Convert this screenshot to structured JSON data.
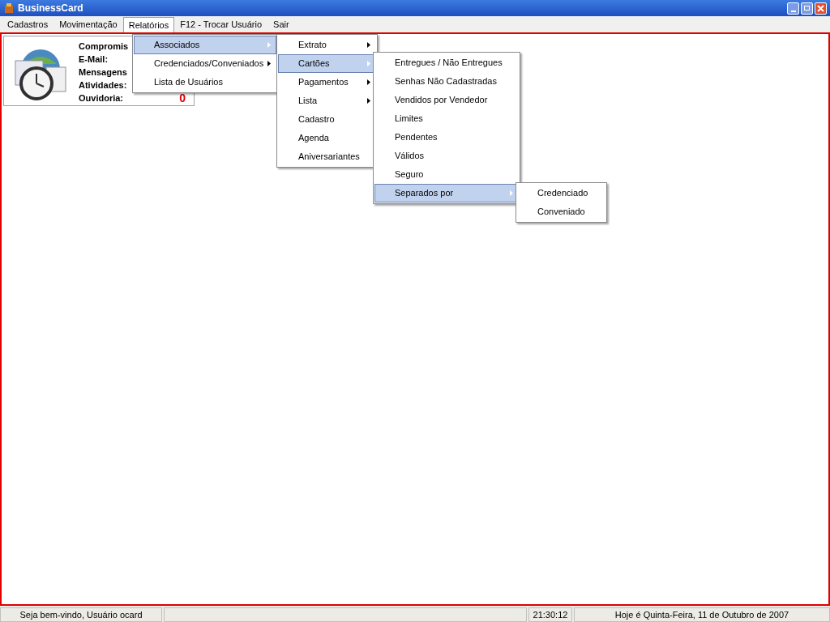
{
  "window": {
    "title": "BusinessCard"
  },
  "menubar": [
    {
      "label": "Cadastros",
      "selected": false
    },
    {
      "label": "Movimentação",
      "selected": false
    },
    {
      "label": "Relatórios",
      "selected": true
    },
    {
      "label": "F12 - Trocar Usuário",
      "selected": false
    },
    {
      "label": "Sair",
      "selected": false
    }
  ],
  "info_card": {
    "rows": [
      {
        "label": "Compromis"
      },
      {
        "label": "E-Mail:"
      },
      {
        "label": "Mensagens"
      },
      {
        "label": "Atividades:"
      },
      {
        "label": "Ouvidoria:",
        "value": "0"
      }
    ]
  },
  "menus": [
    {
      "items": [
        {
          "label": "Associados",
          "selected": true,
          "submenu": true
        },
        {
          "label": "Credenciados/Conveniados",
          "selected": false,
          "submenu": true
        },
        {
          "label": "Lista de Usuários",
          "selected": false,
          "submenu": false
        }
      ]
    },
    {
      "items": [
        {
          "label": "Extrato",
          "selected": false,
          "submenu": true
        },
        {
          "label": "Cartões",
          "selected": true,
          "submenu": true
        },
        {
          "label": "Pagamentos",
          "selected": false,
          "submenu": true
        },
        {
          "label": "Lista",
          "selected": false,
          "submenu": true
        },
        {
          "label": "Cadastro",
          "selected": false,
          "submenu": false
        },
        {
          "label": "Agenda",
          "selected": false,
          "submenu": false
        },
        {
          "label": "Aniversariantes",
          "selected": false,
          "submenu": false
        }
      ]
    },
    {
      "items": [
        {
          "label": "Entregues / Não Entregues",
          "selected": false,
          "submenu": false
        },
        {
          "label": "Senhas Não Cadastradas",
          "selected": false,
          "submenu": false
        },
        {
          "label": "Vendidos por Vendedor",
          "selected": false,
          "submenu": false
        },
        {
          "label": "Limites",
          "selected": false,
          "submenu": false
        },
        {
          "label": "Pendentes",
          "selected": false,
          "submenu": false
        },
        {
          "label": "Válidos",
          "selected": false,
          "submenu": false
        },
        {
          "label": "Seguro",
          "selected": false,
          "submenu": false
        },
        {
          "label": "Separados por",
          "selected": true,
          "submenu": true
        }
      ]
    },
    {
      "items": [
        {
          "label": "Credenciado",
          "selected": false,
          "submenu": false
        },
        {
          "label": "Conveniado",
          "selected": false,
          "submenu": false
        }
      ]
    }
  ],
  "status_bar": {
    "welcome": "Seja bem-vindo, Usuário ocard",
    "time": "21:30:12",
    "date": "Hoje é Quinta-Feira, 11 de Outubro de 2007"
  }
}
